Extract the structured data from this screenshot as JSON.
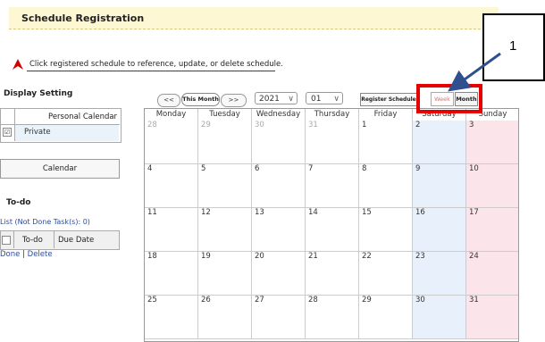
{
  "header": {
    "title": "Schedule Registration"
  },
  "instruction": "Click registered schedule to reference, update, or delete schedule.",
  "display_setting": {
    "title": "Display Setting",
    "calendar_header": "Personal Calendar",
    "calendars": [
      {
        "label": "Private",
        "checked": true
      }
    ],
    "calendar_button": "Calendar"
  },
  "todo": {
    "title": "To-do",
    "list_link": "List (Not Done Task(s): 0)",
    "headers": [
      "To-do",
      "Due Date"
    ],
    "actions": {
      "done": "Done",
      "separator": "|",
      "delete": "Delete"
    }
  },
  "toolbar": {
    "prev": "<<",
    "this_month": "This Month",
    "next": ">>",
    "year": "2021",
    "month": "01",
    "register": "Register Schedule",
    "week": "Week",
    "month_view": "Month"
  },
  "callout": {
    "label": "1"
  },
  "calendar": {
    "days_of_week": [
      "Monday",
      "Tuesday",
      "Wednesday",
      "Thursday",
      "Friday",
      "Saturday",
      "Sunday"
    ],
    "weeks": [
      [
        "28",
        "29",
        "30",
        "31",
        "1",
        "2",
        "3"
      ],
      [
        "4",
        "5",
        "6",
        "7",
        "8",
        "9",
        "10"
      ],
      [
        "11",
        "12",
        "13",
        "14",
        "15",
        "16",
        "17"
      ],
      [
        "18",
        "19",
        "20",
        "21",
        "22",
        "23",
        "24"
      ],
      [
        "25",
        "26",
        "27",
        "28",
        "29",
        "30",
        "31"
      ]
    ],
    "other_month_first_week": 4,
    "colors": {
      "saturday": "#e8f1fb",
      "sunday": "#fbe4ea",
      "highlight": "#e60000"
    }
  }
}
